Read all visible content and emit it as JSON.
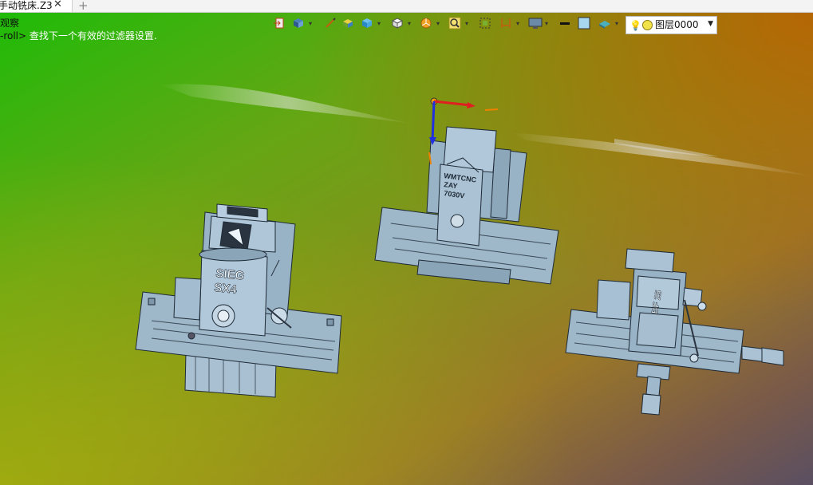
{
  "tabs": [
    {
      "label": "手动铣床.Z3",
      "active": true
    }
  ],
  "command": {
    "line1": "观察",
    "prefix": "-roll>",
    "hint": "查找下一个有效的过滤器设置."
  },
  "toolbar": {
    "icons": [
      "exit-view-icon",
      "view-style-icon",
      "sketch-icon",
      "shaded-box-icon",
      "render-mode-icon",
      "cube-view-icon",
      "sector-icon",
      "zoom-icon",
      "fit-view-icon",
      "dimension-icon",
      "display-icon",
      "line-color-swatch",
      "face-color-swatch",
      "layer-material-icon"
    ],
    "layer_label": "图层0000"
  },
  "models": [
    {
      "name": "SIEG SX4 mill",
      "labels": [
        "SIEG",
        "SX4"
      ]
    },
    {
      "name": "WMTCNC ZAY 7030V mill",
      "labels": [
        "WMTCNC",
        "ZAY",
        "7030V"
      ]
    },
    {
      "name": "BF 25 mill",
      "labels": [
        "BF 25"
      ]
    }
  ],
  "colors": {
    "machine_fill": "#9eb7c9",
    "machine_edge": "#203040",
    "accent_axis_x": "#e02020",
    "accent_axis_z": "#2030e0"
  }
}
